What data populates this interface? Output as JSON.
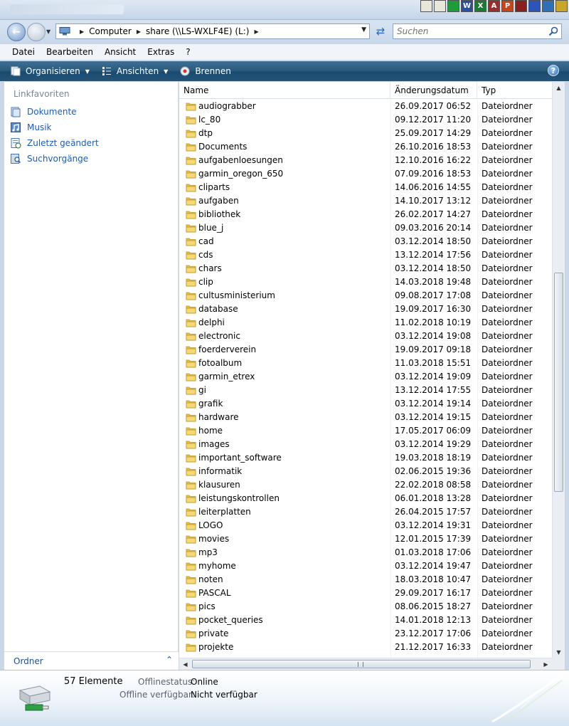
{
  "window": {
    "taskbar_apps": [
      {
        "icon": "document-icon",
        "glyph": "",
        "color": "#e8e6d8"
      },
      {
        "icon": "text-file-icon",
        "glyph": "",
        "color": "#e8e6d8"
      },
      {
        "icon": "green-app-icon",
        "glyph": "",
        "color": "#1f9c3a"
      },
      {
        "icon": "word-icon",
        "glyph": "W",
        "color": "#2b4f9e"
      },
      {
        "icon": "excel-icon",
        "glyph": "X",
        "color": "#1e7a33"
      },
      {
        "icon": "access-icon",
        "glyph": "A",
        "color": "#9c2d2d"
      },
      {
        "icon": "powerpoint-icon",
        "glyph": "P",
        "color": "#c4471c"
      },
      {
        "icon": "key-icon",
        "glyph": "",
        "color": "#8a1f1f"
      },
      {
        "icon": "blue-app-icon",
        "glyph": "",
        "color": "#2d55b8"
      },
      {
        "icon": "globe-icon",
        "glyph": "",
        "color": "#2f6fb8"
      },
      {
        "icon": "clock-icon",
        "glyph": "",
        "color": "#c9a62a"
      }
    ]
  },
  "address": {
    "crumbs": [
      "Computer",
      "share (\\\\LS-WXLF4E) (L:)"
    ],
    "search_placeholder": "Suchen"
  },
  "menu": [
    "Datei",
    "Bearbeiten",
    "Ansicht",
    "Extras",
    "?"
  ],
  "commands": {
    "organize": "Organisieren",
    "views": "Ansichten",
    "burn": "Brennen"
  },
  "nav": {
    "heading": "Linkfavoriten",
    "items": [
      {
        "label": "Dokumente",
        "icon": "documents-icon"
      },
      {
        "label": "Musik",
        "icon": "music-icon"
      },
      {
        "label": "Zuletzt geändert",
        "icon": "recent-icon"
      },
      {
        "label": "Suchvorgänge",
        "icon": "searches-icon"
      }
    ],
    "folders_label": "Ordner"
  },
  "columns": {
    "name": "Name",
    "date": "Änderungsdatum",
    "type": "Typ"
  },
  "files": [
    {
      "name": "audiograbber",
      "date": "26.09.2017 06:52",
      "type": "Dateiordner"
    },
    {
      "name": "lc_80",
      "date": "09.12.2017 11:20",
      "type": "Dateiordner"
    },
    {
      "name": "dtp",
      "date": "25.09.2017 14:29",
      "type": "Dateiordner"
    },
    {
      "name": "Documents",
      "date": "26.10.2016 18:53",
      "type": "Dateiordner"
    },
    {
      "name": "aufgabenloesungen",
      "date": "12.10.2016 16:22",
      "type": "Dateiordner"
    },
    {
      "name": "garmin_oregon_650",
      "date": "07.09.2016 18:53",
      "type": "Dateiordner"
    },
    {
      "name": "cliparts",
      "date": "14.06.2016 14:55",
      "type": "Dateiordner"
    },
    {
      "name": "aufgaben",
      "date": "14.10.2017 13:12",
      "type": "Dateiordner"
    },
    {
      "name": "bibliothek",
      "date": "26.02.2017 14:27",
      "type": "Dateiordner"
    },
    {
      "name": "blue_j",
      "date": "09.03.2016 20:14",
      "type": "Dateiordner"
    },
    {
      "name": "cad",
      "date": "03.12.2014 18:50",
      "type": "Dateiordner"
    },
    {
      "name": "cds",
      "date": "13.12.2014 17:56",
      "type": "Dateiordner"
    },
    {
      "name": "chars",
      "date": "03.12.2014 18:50",
      "type": "Dateiordner"
    },
    {
      "name": "clip",
      "date": "14.03.2018 19:48",
      "type": "Dateiordner"
    },
    {
      "name": "cultusministerium",
      "date": "09.08.2017 17:08",
      "type": "Dateiordner"
    },
    {
      "name": "database",
      "date": "19.09.2017 16:30",
      "type": "Dateiordner"
    },
    {
      "name": "delphi",
      "date": "11.02.2018 10:19",
      "type": "Dateiordner"
    },
    {
      "name": "electronic",
      "date": "03.12.2014 19:08",
      "type": "Dateiordner"
    },
    {
      "name": "foerderverein",
      "date": "19.09.2017 09:18",
      "type": "Dateiordner"
    },
    {
      "name": "fotoalbum",
      "date": "11.03.2018 15:51",
      "type": "Dateiordner"
    },
    {
      "name": "garmin_etrex",
      "date": "03.12.2014 19:09",
      "type": "Dateiordner"
    },
    {
      "name": "gi",
      "date": "13.12.2014 17:55",
      "type": "Dateiordner"
    },
    {
      "name": "grafik",
      "date": "03.12.2014 19:14",
      "type": "Dateiordner"
    },
    {
      "name": "hardware",
      "date": "03.12.2014 19:15",
      "type": "Dateiordner"
    },
    {
      "name": "home",
      "date": "17.05.2017 06:09",
      "type": "Dateiordner"
    },
    {
      "name": "images",
      "date": "03.12.2014 19:29",
      "type": "Dateiordner"
    },
    {
      "name": "important_software",
      "date": "19.03.2018 18:19",
      "type": "Dateiordner"
    },
    {
      "name": "informatik",
      "date": "02.06.2015 19:36",
      "type": "Dateiordner"
    },
    {
      "name": "klausuren",
      "date": "22.02.2018 08:58",
      "type": "Dateiordner"
    },
    {
      "name": "leistungskontrollen",
      "date": "06.01.2018 13:28",
      "type": "Dateiordner"
    },
    {
      "name": "leiterplatten",
      "date": "26.04.2015 17:57",
      "type": "Dateiordner"
    },
    {
      "name": "LOGO",
      "date": "03.12.2014 19:31",
      "type": "Dateiordner"
    },
    {
      "name": "movies",
      "date": "12.01.2015 17:39",
      "type": "Dateiordner"
    },
    {
      "name": "mp3",
      "date": "01.03.2018 17:06",
      "type": "Dateiordner"
    },
    {
      "name": "myhome",
      "date": "03.12.2014 19:47",
      "type": "Dateiordner"
    },
    {
      "name": "noten",
      "date": "18.03.2018 10:47",
      "type": "Dateiordner"
    },
    {
      "name": "PASCAL",
      "date": "29.09.2017 16:17",
      "type": "Dateiordner"
    },
    {
      "name": "pics",
      "date": "08.06.2015 18:27",
      "type": "Dateiordner"
    },
    {
      "name": "pocket_queries",
      "date": "14.01.2018 12:13",
      "type": "Dateiordner"
    },
    {
      "name": "private",
      "date": "23.12.2017 17:06",
      "type": "Dateiordner"
    },
    {
      "name": "projekte",
      "date": "21.12.2017 16:33",
      "type": "Dateiordner"
    }
  ],
  "details": {
    "count": "57 Elemente",
    "offline_status_label": "Offlinestatus:",
    "offline_status_value": "Online",
    "offline_avail_label": "Offline verfügbar:",
    "offline_avail_value": "Nicht verfügbar"
  },
  "colors": {
    "link": "#1e5cb3",
    "command_bar": "#2b5c80",
    "folder": "#e9c24a"
  }
}
